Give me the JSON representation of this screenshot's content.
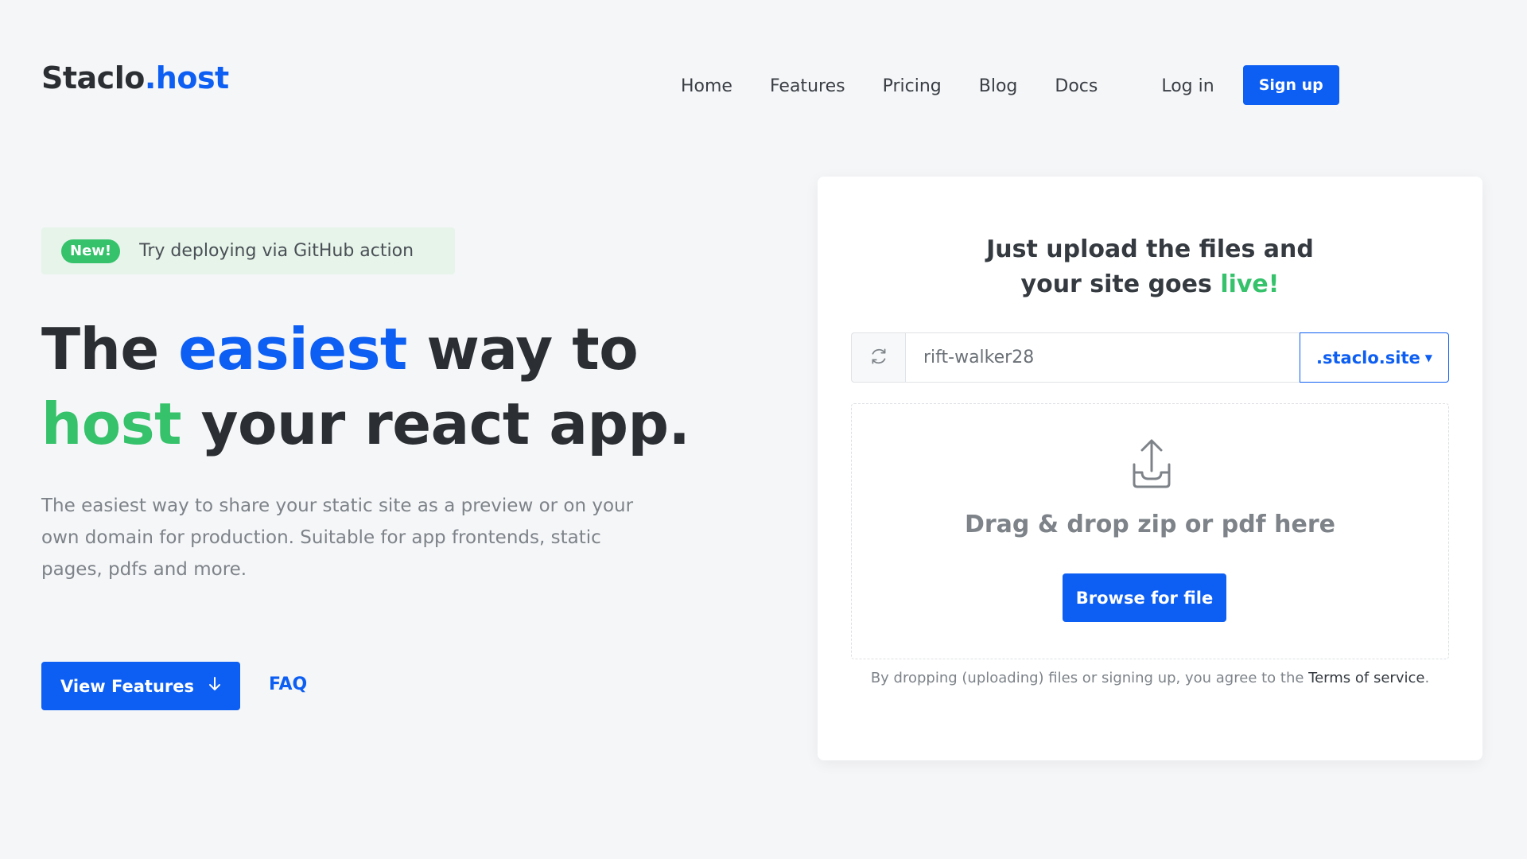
{
  "header": {
    "logo_main": "Staclo",
    "logo_accent": ".host",
    "nav": [
      "Home",
      "Features",
      "Pricing",
      "Blog",
      "Docs"
    ],
    "login_label": "Log in",
    "signup_label": "Sign up"
  },
  "hero": {
    "badge": "New!",
    "announcement": "Try deploying via GitHub action",
    "title_1": "The ",
    "title_2": "easiest",
    "title_3": " way to",
    "title_4": "host",
    "title_5": " your react app.",
    "subtitle": "The easiest way to share your static site as a preview or on your own domain for production. Suitable for app frontends, static pages, pdfs and more.",
    "view_features_label": "View Features",
    "faq_label": "FAQ"
  },
  "upload": {
    "title_line1": "Just upload the files and",
    "title_line2": "your site goes ",
    "title_live": "live!",
    "subdomain_value": "rift-walker28",
    "suffix_label": ".staclo.site",
    "drop_text": "Drag & drop zip or pdf here",
    "browse_label": "Browse for file",
    "terms_text": "By dropping (uploading) files or signing up, you agree to the ",
    "terms_link": "Terms of service",
    "terms_end": "."
  },
  "icons": {
    "refresh": "refresh-icon",
    "upload": "upload-icon",
    "arrow": "arrow-down-icon",
    "caret": "caret-down-icon"
  },
  "colors": {
    "primary": "#0d5ef2",
    "green": "#35c26b",
    "background": "#f5f6f8"
  }
}
